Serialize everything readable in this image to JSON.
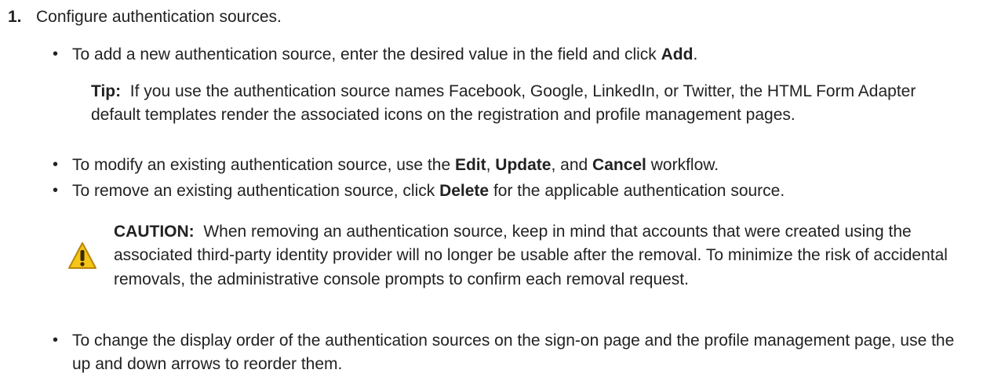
{
  "step": {
    "number": "1.",
    "title": "Configure authentication sources."
  },
  "bullets": [
    {
      "pre": "To add a new authentication source, enter the desired value in the field and click ",
      "bold": "Add",
      "post": "."
    },
    {
      "pre": "To modify an existing authentication source, use the ",
      "bold1": "Edit",
      "mid1": ", ",
      "bold2": "Update",
      "mid2": ", and ",
      "bold3": "Cancel",
      "post": " workflow."
    },
    {
      "pre": "To remove an existing authentication source, click ",
      "bold": "Delete",
      "post": " for the applicable authentication source."
    },
    {
      "text": "To change the display order of the authentication sources on the sign-on page and the profile management page, use the up and down arrows to reorder them."
    }
  ],
  "tip": {
    "label": "Tip:",
    "text": "If you use the authentication source names Facebook, Google, LinkedIn, or Twitter, the HTML Form Adapter default templates render the associated icons on the registration and profile management pages."
  },
  "caution": {
    "label": "CAUTION:",
    "text": "When removing an authentication source, keep in mind that accounts that were created using the associated third-party identity provider will no longer be usable after the removal. To minimize the risk of accidental removals, the administrative console prompts to confirm each removal request.",
    "icon": "warning-icon",
    "icon_color": "#f5c518",
    "icon_stroke": "#b8860b"
  },
  "bullet_symbol": "•"
}
